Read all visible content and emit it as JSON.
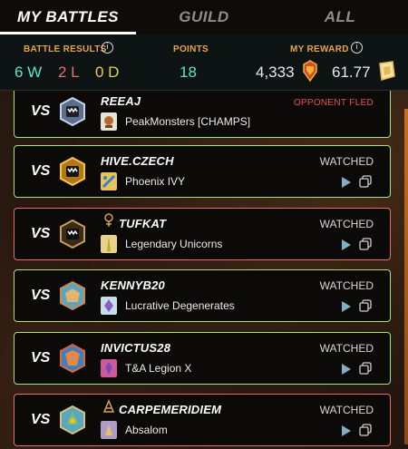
{
  "tabs": [
    {
      "label": "MY BATTLES",
      "active": true
    },
    {
      "label": "GUILD",
      "active": false
    },
    {
      "label": "ALL",
      "active": false
    }
  ],
  "summary": {
    "battle_results_label": "BATTLE RESULTS",
    "points_label": "POINTS",
    "reward_label": "MY REWARD",
    "info_glyph": "i",
    "wins": "6 W",
    "losses": "2 L",
    "draws": "0 D",
    "points": "18",
    "reward_dec": "4,333",
    "reward_sps": "61.77"
  },
  "vs_label": "VS",
  "battles": [
    {
      "opponent": "REEAJ",
      "guild": "PeakMonsters [CHAMPS]",
      "status": "OPPONENT FLED",
      "result": "win",
      "title_icon": false
    },
    {
      "opponent": "HIVE.CZECH",
      "guild": "Phoenix IVY",
      "status": "WATCHED",
      "result": "win",
      "title_icon": false
    },
    {
      "opponent": "TUFKAT",
      "guild": "Legendary Unicorns",
      "status": "WATCHED",
      "result": "loss",
      "title_icon": true
    },
    {
      "opponent": "KENNYB20",
      "guild": "Lucrative Degenerates",
      "status": "WATCHED",
      "result": "win",
      "title_icon": false
    },
    {
      "opponent": "INVICTUS28",
      "guild": "T&A Legion X",
      "status": "WATCHED",
      "result": "win",
      "title_icon": false
    },
    {
      "opponent": "CARPEMERIDIEM",
      "guild": "Absalom",
      "status": "WATCHED",
      "result": "loss",
      "title_icon": true
    }
  ],
  "colors": {
    "win_border": "#a6e27a",
    "loss_border": "#e0706a",
    "accent_orange": "#e7a34a",
    "teal": "#5fe3c9"
  }
}
